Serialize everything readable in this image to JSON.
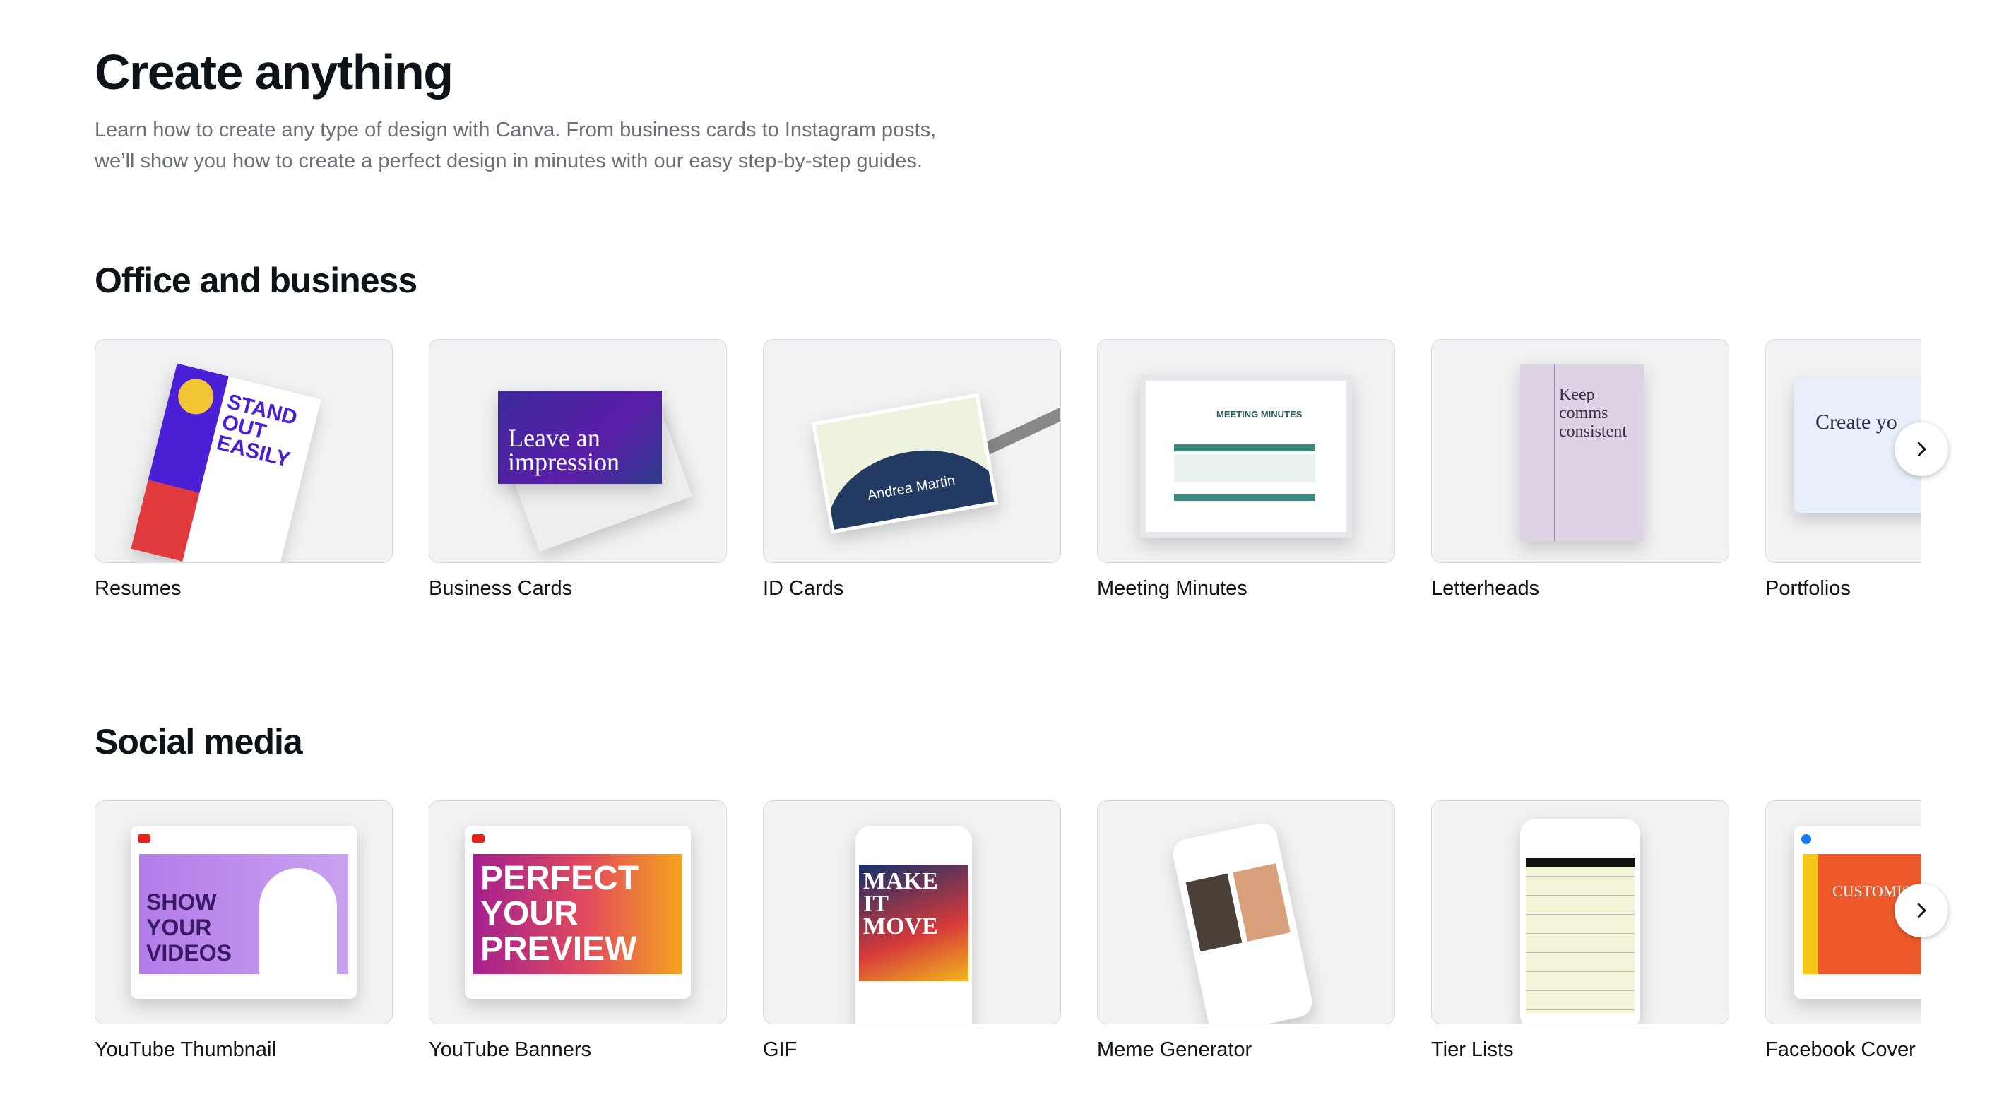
{
  "page": {
    "title": "Create anything",
    "intro_line1": "Learn how to create any type of design with Canva. From business cards to Instagram posts,",
    "intro_line2": "we’ll show you how to create a perfect design in minutes with our easy step-by-step guides."
  },
  "sections": [
    {
      "title": "Office and business",
      "next_icon": "chevron-right-icon",
      "items": [
        {
          "label": "Resumes",
          "thumb_text": "STAND OUT EASILY"
        },
        {
          "label": "Business Cards",
          "thumb_text": "Leave an impression"
        },
        {
          "label": "ID Cards",
          "thumb_text": "Andrea Martin"
        },
        {
          "label": "Meeting Minutes",
          "thumb_text": "MEETING MINUTES"
        },
        {
          "label": "Letterheads",
          "thumb_text": "Keep comms consistent"
        },
        {
          "label": "Portfolios",
          "thumb_text": "Create yo"
        }
      ]
    },
    {
      "title": "Social media",
      "next_icon": "chevron-right-icon",
      "items": [
        {
          "label": "YouTube Thumbnail",
          "thumb_text": "SHOW YOUR VIDEOS"
        },
        {
          "label": "YouTube Banners",
          "thumb_text": "PERFECT YOUR PREVIEW"
        },
        {
          "label": "GIF",
          "thumb_text": "MAKE IT MOVE"
        },
        {
          "label": "Meme Generator",
          "thumb_text": ""
        },
        {
          "label": "Tier Lists",
          "thumb_text": ""
        },
        {
          "label": "Facebook Cover",
          "thumb_text": "CUSTOMISE YO"
        }
      ]
    }
  ]
}
